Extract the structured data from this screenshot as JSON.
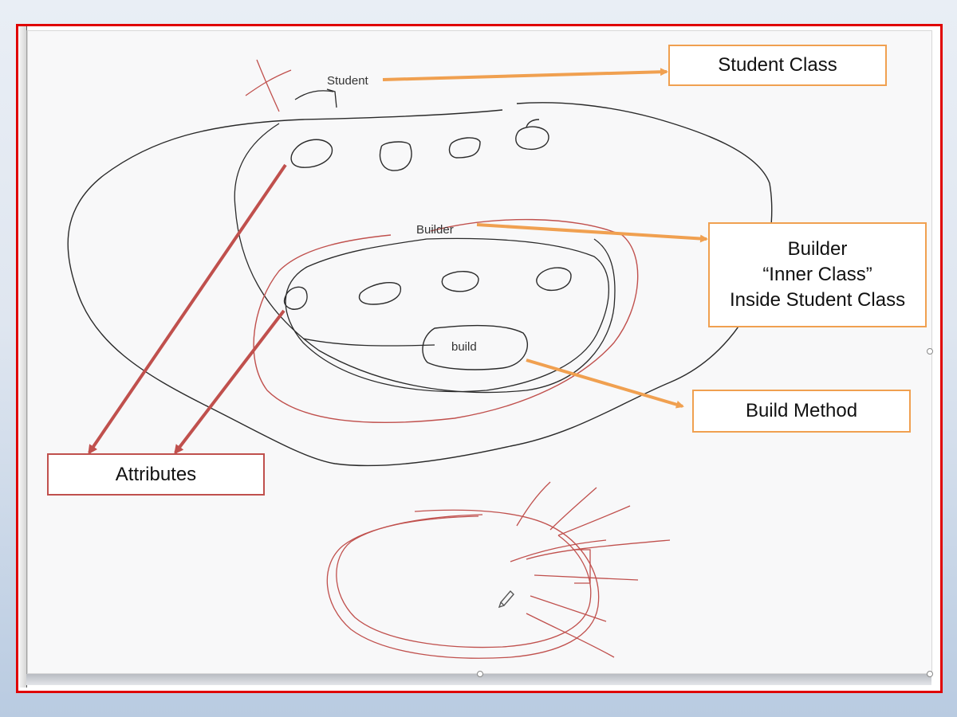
{
  "callouts": {
    "student_class": "Student Class",
    "builder": [
      "Builder",
      "“Inner Class”",
      "Inside Student Class"
    ],
    "build_method": "Build Method",
    "attributes": "Attributes"
  },
  "sketch_labels": {
    "student": "Student",
    "builder": "Builder",
    "build": "build"
  },
  "colors": {
    "frame_border": "#e00000",
    "orange_arrow": "#f0a050",
    "red_arrow": "#c0504d",
    "ink_black": "#2a2a2a",
    "ink_red": "#c0504d"
  }
}
